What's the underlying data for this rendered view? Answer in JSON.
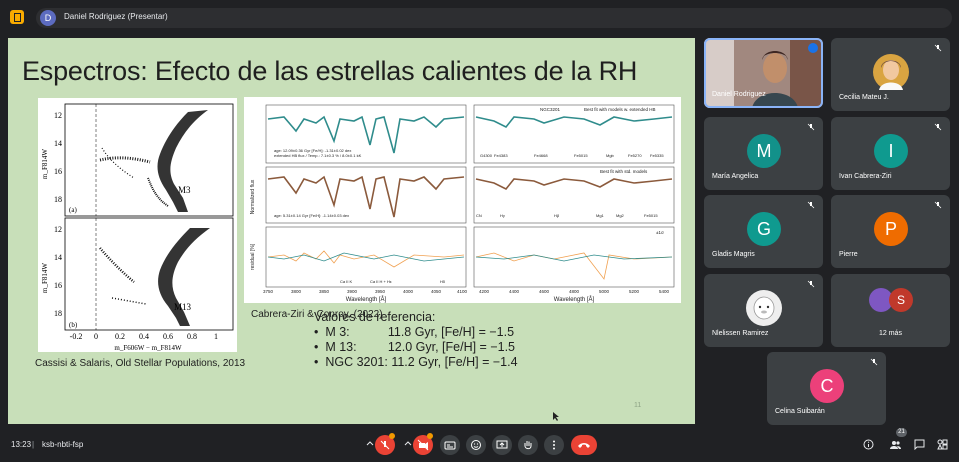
{
  "presenter_chip": {
    "avatar_letter": "D",
    "label": "Daniel Rodriguez (Presentar)"
  },
  "slide": {
    "title": "Espectros: Efecto de las estrellas calientes de la RH",
    "caption_left": "Cassisi & Salaris, Old Stellar Populations, 2013",
    "caption_right": "Cabrera-Ziri & Conroy, (2022)",
    "refs_title": "Valores de referencia:",
    "refs": [
      "M 3:           11.8 Gyr, [Fe/H] = −1.5",
      "M 13:         12.0 Gyr, [Fe/H] = −1.5",
      "NGC 3201: 11.2 Gyr, [Fe/H] = −1.4"
    ],
    "page_number": "11",
    "cmd": {
      "panel_a_label": "(a)",
      "panel_b_label": "(b)",
      "panel_a_name": "M3",
      "panel_b_name": "M13",
      "y_label": "m_F814W",
      "x_label": "m_F606W − m_F814W",
      "y_ticks": [
        "12",
        "14",
        "16",
        "18"
      ],
      "x_ticks": [
        "-0.2",
        "0",
        "0.2",
        "0.4",
        "0.6",
        "0.8",
        "1"
      ]
    },
    "spectra": {
      "ylabel_top": "Normalized flux",
      "ylabel_bottom": "residual [%]",
      "xlabel": "Wavelength [Å]",
      "legend_1": "NGC3201",
      "legend_2": "Best fit with models w. extended HB",
      "legend_3": "Best fit with std. models",
      "legend_sigma": "±1σ",
      "fit_text_1a": "age: 12.09±0.36 Gyr  [Fe/H]: -1.31±0.02 dex",
      "fit_text_1b": "extended HB flux / Temp.: 7.1±0.3 % / 8.0±0.1 kK",
      "fit_text_2": "age: 5.31±0.14 Gyr  [Fe/H]: -1.14±0.03 dex",
      "x_ticks_left": [
        "3750",
        "3800",
        "3850",
        "3900",
        "3950",
        "4000",
        "4050",
        "4100"
      ],
      "x_ticks_right": [
        "4200",
        "4400",
        "4600",
        "4800",
        "5000",
        "5200",
        "5400"
      ],
      "line_labels_top": [
        "G4300",
        "Fe4383",
        "Fe4668",
        "Fe5015",
        "Mgb",
        "Fe5270",
        "Fe5335"
      ],
      "line_labels_bottom": [
        "CN",
        "Hγ",
        "Hβ",
        "Mg1",
        "Mg2",
        "Fe5015"
      ],
      "resid_labels": [
        "Ca II K",
        "Ca II H + Hε",
        "Hδ"
      ],
      "colors": {
        "teal": "#2f8c8c",
        "brown": "#8b5a3c",
        "orange": "#f0a050"
      }
    }
  },
  "participants": [
    {
      "name": "Daniel Rodriguez",
      "letter": "",
      "color": "#6d4c41",
      "active": true
    },
    {
      "name": "Cecilia Mateu J.",
      "letter": "",
      "color": "#d9a441",
      "active": false
    },
    {
      "name": "María Angelica",
      "letter": "M",
      "color": "#12918a",
      "active": false
    },
    {
      "name": "Ivan Cabrera-Ziri",
      "letter": "I",
      "color": "#0f9a8f",
      "active": false
    },
    {
      "name": "Gladis Magris",
      "letter": "G",
      "color": "#0f9a8f",
      "active": false
    },
    {
      "name": "Pierre",
      "letter": "P",
      "color": "#ef6c00",
      "active": false
    },
    {
      "name": "Nlelissen Ramirez",
      "letter": "",
      "color": "#e0e0e0",
      "active": false
    },
    {
      "name": "12 más",
      "letter": "S",
      "color": "#c0392b",
      "active": false
    },
    {
      "name": "Celina Suibarán",
      "letter": "C",
      "color": "#ec407a",
      "active": false
    }
  ],
  "bottombar": {
    "time": "13:23",
    "separator": "|",
    "meeting_code": "ksb-nbti-fsp",
    "people_count": "21"
  },
  "colors": {
    "accent": "#8ab4f8",
    "danger": "#ea4335",
    "slide_bg": "#c8dfb9"
  }
}
